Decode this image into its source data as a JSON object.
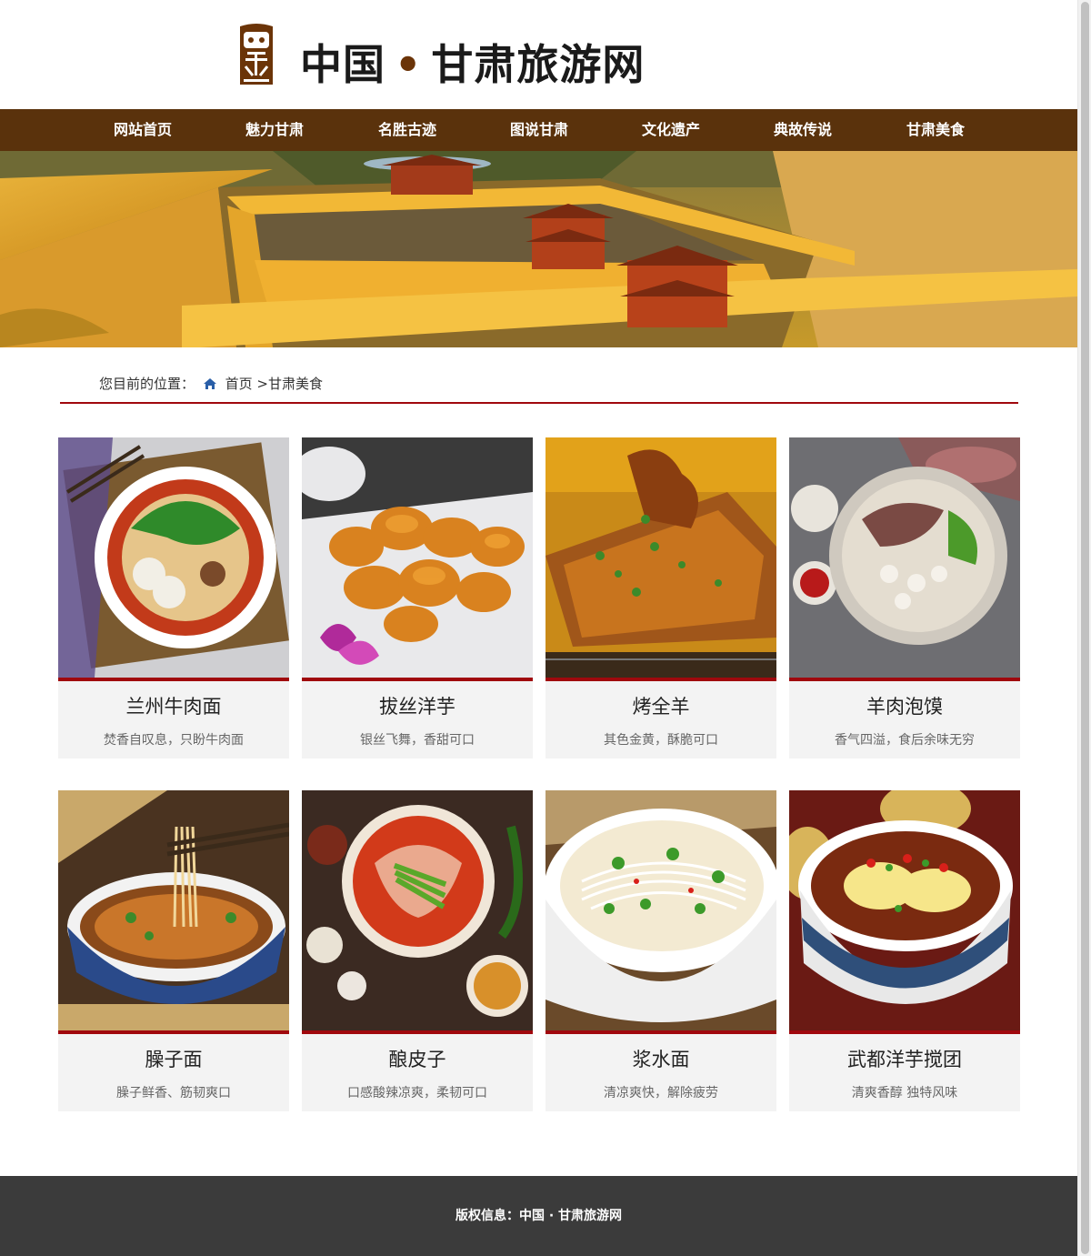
{
  "header": {
    "title_left": "中国",
    "title_dot": "•",
    "title_right": "甘肃旅游网"
  },
  "nav": {
    "items": [
      "网站首页",
      "魅力甘肃",
      "名胜古迹",
      "图说甘肃",
      "文化遗产",
      "典故传说",
      "甘肃美食"
    ]
  },
  "breadcrumb": {
    "prefix": "您目前的位置：",
    "home": "首页",
    "separator": ">",
    "current": "甘肃美食"
  },
  "foods": [
    {
      "name": "兰州牛肉面",
      "desc": "焚香自叹息，只盼牛肉面"
    },
    {
      "name": "拔丝洋芋",
      "desc": "银丝飞舞，香甜可口"
    },
    {
      "name": "烤全羊",
      "desc": "其色金黄，酥脆可口"
    },
    {
      "name": "羊肉泡馍",
      "desc": "香气四溢，食后余味无穷"
    },
    {
      "name": "臊子面",
      "desc": "臊子鲜香、筋韧爽口"
    },
    {
      "name": "酿皮子",
      "desc": "口感酸辣凉爽，柔韧可口"
    },
    {
      "name": "浆水面",
      "desc": "清凉爽快，解除疲劳"
    },
    {
      "name": "武都洋芋搅团",
      "desc": "清爽香醇 独特风味"
    }
  ],
  "footer": {
    "text": "版权信息：中国 · 甘肃旅游网"
  },
  "colors": {
    "nav_bg": "#5a320c",
    "accent_red": "#a0080d",
    "footer_bg": "#3b3b3b",
    "card_bg": "#f3f3f3"
  }
}
